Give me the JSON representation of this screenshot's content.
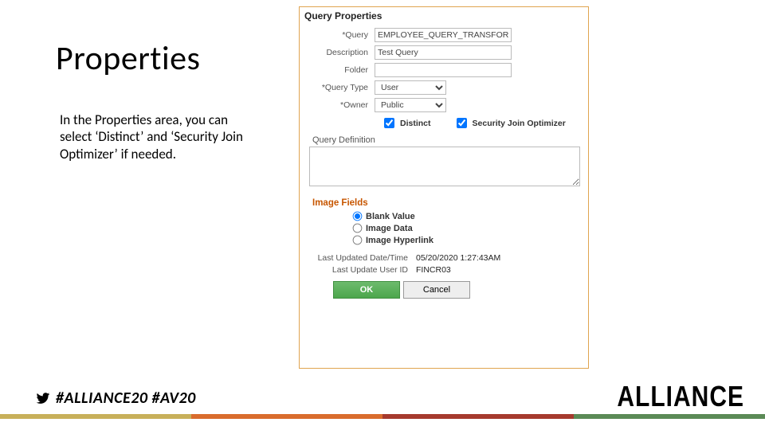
{
  "slide": {
    "title": "Properties",
    "body": "In the Properties area, you can select ‘Distinct’ and ‘Security Join Optimizer’ if needed."
  },
  "panel": {
    "title": "Query Properties",
    "fields": {
      "query_label": "*Query",
      "query_value": "EMPLOYEE_QUERY_TRANSFORM",
      "description_label": "Description",
      "description_value": "Test Query",
      "folder_label": "Folder",
      "folder_value": "",
      "type_label": "*Query Type",
      "type_value": "User",
      "owner_label": "*Owner",
      "owner_value": "Public"
    },
    "checkboxes": {
      "distinct_label": "Distinct",
      "distinct_checked": true,
      "sjo_label": "Security Join Optimizer",
      "sjo_checked": true
    },
    "qdef_label": "Query Definition",
    "qdef_value": "",
    "image_fields": {
      "heading": "Image Fields",
      "options": [
        {
          "label": "Blank Value",
          "checked": true
        },
        {
          "label": "Image Data",
          "checked": false
        },
        {
          "label": "Image Hyperlink",
          "checked": false
        }
      ]
    },
    "meta": {
      "updated_label": "Last Updated Date/Time",
      "updated_value": "05/20/2020  1:27:43AM",
      "user_label": "Last Update User ID",
      "user_value": "FINCR03"
    },
    "buttons": {
      "ok": "OK",
      "cancel": "Cancel"
    }
  },
  "footer": {
    "hashtags": "#ALLIANCE20 #AV20",
    "wordmark": "ALLIANCE"
  }
}
